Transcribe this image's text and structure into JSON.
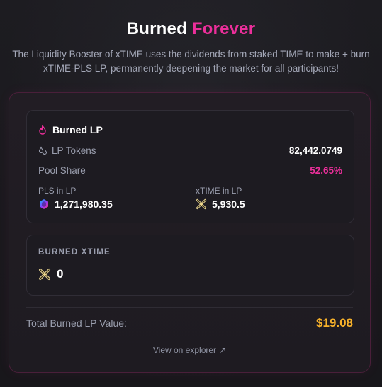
{
  "header": {
    "title_main": "Burned",
    "title_accent": "Forever",
    "description": "The Liquidity Booster of xTIME uses the dividends from staked TIME to make + burn xTIME-PLS LP, permanently deepening the market for all participants!"
  },
  "burned_lp": {
    "heading": "Burned LP",
    "heading_icon": "flame-icon",
    "lp_tokens_label": "LP Tokens",
    "lp_tokens_icon": "droplets-icon",
    "lp_tokens_value": "82,442.0749",
    "pool_share_label": "Pool Share",
    "pool_share_value": "52.65%",
    "pls_label": "PLS in LP",
    "pls_icon": "pls-token-icon",
    "pls_value": "1,271,980.35",
    "xtime_label": "xTIME in LP",
    "xtime_icon": "xtime-token-icon",
    "xtime_value": "5,930.5"
  },
  "burned_xtime": {
    "label": "BURNED XTIME",
    "icon": "xtime-token-icon",
    "value": "0"
  },
  "total": {
    "label": "Total Burned LP Value:",
    "value": "$19.08"
  },
  "explorer": {
    "label": "View on explorer",
    "icon": "external-link-icon"
  },
  "colors": {
    "accent_pink": "#ec2f9b",
    "gold": "#f7b12a",
    "background": "#1b1a1f",
    "muted_text": "#9a9eae"
  }
}
